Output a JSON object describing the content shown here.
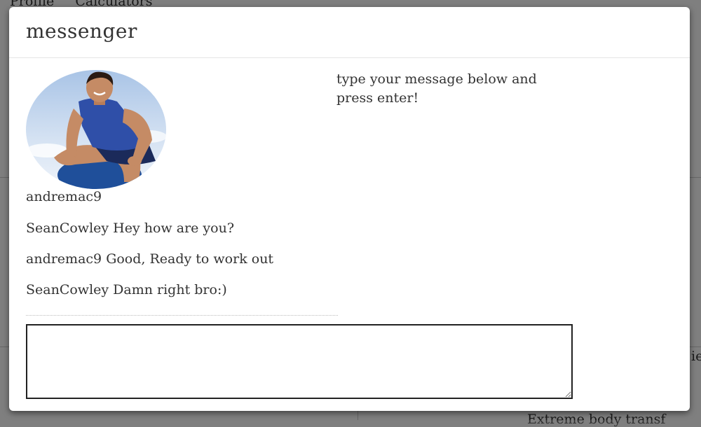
{
  "background": {
    "nav_items": [
      "Profile",
      "Calculators"
    ],
    "footer_text": "Extreme body transf",
    "side_text": "ie"
  },
  "modal": {
    "title": "messenger",
    "instructions": "type your message below and press enter!",
    "user": {
      "username": "andremac9",
      "avatar": "user-avatar-photo"
    },
    "messages": [
      {
        "sender": "SeanCowley",
        "text": "Hey how are you?"
      },
      {
        "sender": "andremac9",
        "text": "Good, Ready to work out"
      },
      {
        "sender": "SeanCowley",
        "text": "Damn right bro:)"
      }
    ],
    "input": {
      "value": "",
      "placeholder": ""
    }
  }
}
